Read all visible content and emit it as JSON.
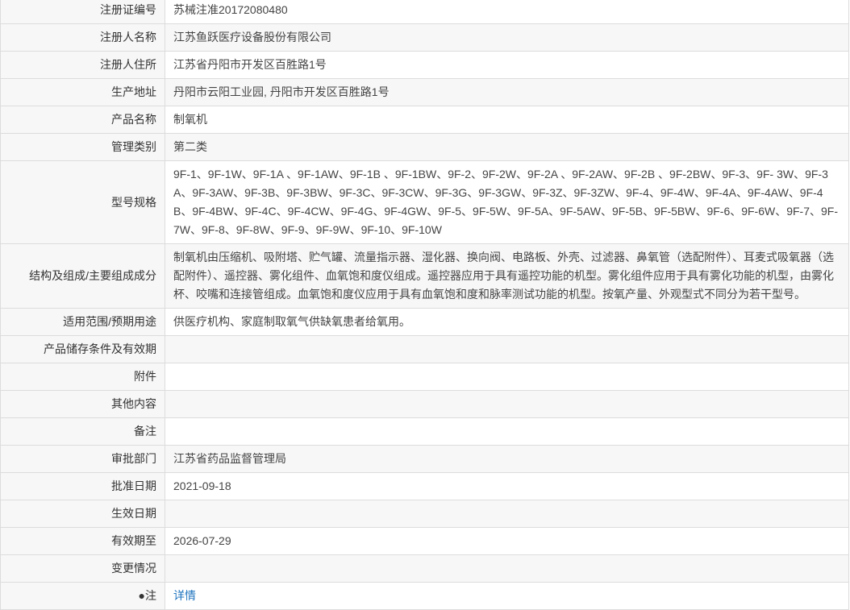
{
  "fields": {
    "reg_no": {
      "label": "注册证编号",
      "value": "苏械注准20172080480"
    },
    "registrant_name": {
      "label": "注册人名称",
      "value": "江苏鱼跃医疗设备股份有限公司"
    },
    "registrant_address": {
      "label": "注册人住所",
      "value": "江苏省丹阳市开发区百胜路1号"
    },
    "production_address": {
      "label": "生产地址",
      "value": "丹阳市云阳工业园, 丹阳市开发区百胜路1号"
    },
    "product_name": {
      "label": "产品名称",
      "value": "制氧机"
    },
    "management_class": {
      "label": "管理类别",
      "value": "第二类"
    },
    "model_spec": {
      "label": "型号规格",
      "value": "9F-1、9F-1W、9F-1A 、9F-1AW、9F-1B 、9F-1BW、9F-2、9F-2W、9F-2A 、9F-2AW、9F-2B 、9F-2BW、9F-3、9F- 3W、9F-3A、9F-3AW、9F-3B、9F-3BW、9F-3C、9F-3CW、9F-3G、9F-3GW、9F-3Z、9F-3ZW、9F-4、9F-4W、9F-4A、9F-4AW、9F-4B、9F-4BW、9F-4C、9F-4CW、9F-4G、9F-4GW、9F-5、9F-5W、9F-5A、9F-5AW、9F-5B、9F-5BW、9F-6、9F-6W、9F-7、9F-7W、9F-8、9F-8W、9F-9、9F-9W、9F-10、9F-10W"
    },
    "structure": {
      "label": "结构及组成/主要组成成分",
      "value": "制氧机由压缩机、吸附塔、贮气罐、流量指示器、湿化器、换向阀、电路板、外壳、过滤器、鼻氧管（选配附件）、耳麦式吸氧器（选配附件）、遥控器、雾化组件、血氧饱和度仪组成。遥控器应用于具有遥控功能的机型。雾化组件应用于具有雾化功能的机型，由雾化杯、咬嘴和连接管组成。血氧饱和度仪应用于具有血氧饱和度和脉率测试功能的机型。按氧产量、外观型式不同分为若干型号。"
    },
    "intended_use": {
      "label": "适用范围/预期用途",
      "value": "供医疗机构、家庭制取氧气供缺氧患者给氧用。"
    },
    "storage": {
      "label": "产品储存条件及有效期",
      "value": ""
    },
    "attachment": {
      "label": "附件",
      "value": ""
    },
    "other": {
      "label": "其他内容",
      "value": ""
    },
    "remarks": {
      "label": "备注",
      "value": ""
    },
    "approval_dept": {
      "label": "审批部门",
      "value": "江苏省药品监督管理局"
    },
    "approval_date": {
      "label": "批准日期",
      "value": "2021-09-18"
    },
    "effective_date": {
      "label": "生效日期",
      "value": ""
    },
    "valid_until": {
      "label": "有效期至",
      "value": "2026-07-29"
    },
    "changes": {
      "label": "变更情况",
      "value": ""
    },
    "note": {
      "label": "●注",
      "value": "详情"
    }
  }
}
